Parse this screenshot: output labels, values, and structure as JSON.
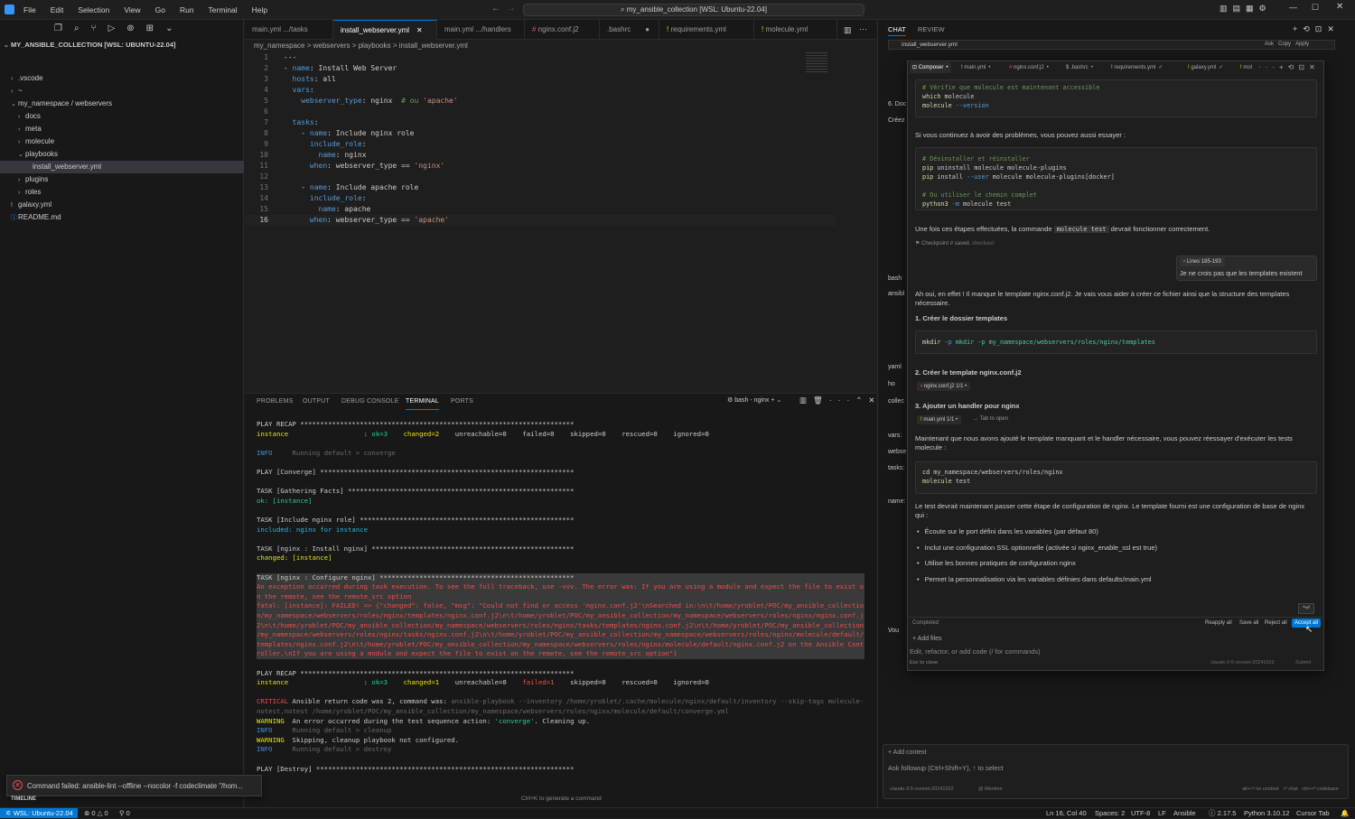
{
  "menu": [
    "File",
    "Edit",
    "Selection",
    "View",
    "Go",
    "Run",
    "Terminal",
    "Help"
  ],
  "command_center": "my_ansible_collection [WSL: Ubuntu-22.04]",
  "explorer": {
    "root": "MY_ANSIBLE_COLLECTION [WSL: UBUNTU-22.04]",
    "items": [
      {
        "label": ".vscode",
        "type": "folder"
      },
      {
        "label": "~",
        "type": "folder"
      },
      {
        "label": "my_namespace / webservers",
        "type": "folder-open"
      },
      {
        "label": "docs",
        "type": "folder"
      },
      {
        "label": "meta",
        "type": "folder"
      },
      {
        "label": "molecule",
        "type": "folder"
      },
      {
        "label": "playbooks",
        "type": "folder-open"
      },
      {
        "label": "install_webserver.yml",
        "type": "file"
      },
      {
        "label": "plugins",
        "type": "folder"
      },
      {
        "label": "roles",
        "type": "folder"
      },
      {
        "label": "galaxy.yml",
        "type": "file"
      },
      {
        "label": "README.md",
        "type": "file"
      }
    ]
  },
  "tabs": [
    {
      "label": "main.yml .../tasks"
    },
    {
      "label": "install_webserver.yml"
    },
    {
      "label": "main.yml .../handlers"
    },
    {
      "label": "nginx.conf.j2"
    },
    {
      "label": ".bashrc"
    },
    {
      "label": "requirements.yml"
    },
    {
      "label": "molecule.yml"
    }
  ],
  "breadcrumb": "my_namespace  >  webservers  >  playbooks  >  install_webserver.yml",
  "code": [
    {
      "n": "1",
      "t": "---"
    },
    {
      "n": "2",
      "t": "- name: Install Web Server"
    },
    {
      "n": "3",
      "t": "  hosts: all"
    },
    {
      "n": "4",
      "t": "  vars:"
    },
    {
      "n": "5",
      "t": "    webserver_type: nginx  # ou 'apache'"
    },
    {
      "n": "6",
      "t": ""
    },
    {
      "n": "7",
      "t": "  tasks:"
    },
    {
      "n": "8",
      "t": "    - name: Include nginx role"
    },
    {
      "n": "9",
      "t": "      include_role:"
    },
    {
      "n": "10",
      "t": "        name: nginx"
    },
    {
      "n": "11",
      "t": "      when: webserver_type == 'nginx'"
    },
    {
      "n": "12",
      "t": ""
    },
    {
      "n": "13",
      "t": "    - name: Include apache role"
    },
    {
      "n": "14",
      "t": "      include_role:"
    },
    {
      "n": "15",
      "t": "        name: apache"
    },
    {
      "n": "16",
      "t": "      when: webserver_type == 'apache'"
    }
  ],
  "panel_tabs": [
    "PROBLEMS",
    "OUTPUT",
    "DEBUG CONSOLE",
    "TERMINAL",
    "PORTS"
  ],
  "terminal_name": "bash - nginx",
  "terminal": [
    {
      "t": "PLAY RECAP *********************************************************************",
      "c": ""
    },
    {
      "t": "instance                   : ok=3    changed=2    unreachable=0    failed=0    skipped=0    rescued=0    ignored=0",
      "c": "recap"
    },
    {
      "t": "",
      "c": ""
    },
    {
      "t": "INFO     Running default > converge",
      "c": "info"
    },
    {
      "t": "",
      "c": ""
    },
    {
      "t": "PLAY [Converge] ****************************************************************",
      "c": ""
    },
    {
      "t": "",
      "c": ""
    },
    {
      "t": "TASK [Gathering Facts] *********************************************************",
      "c": ""
    },
    {
      "t": "ok: [instance]",
      "c": "green"
    },
    {
      "t": "",
      "c": ""
    },
    {
      "t": "TASK [Include nginx role] ******************************************************",
      "c": ""
    },
    {
      "t": "included: nginx for instance",
      "c": "cyan"
    },
    {
      "t": "",
      "c": ""
    },
    {
      "t": "TASK [nginx : Install nginx] ***************************************************",
      "c": ""
    },
    {
      "t": "changed: [instance]",
      "c": "yel"
    },
    {
      "t": "",
      "c": ""
    },
    {
      "t": "TASK [nginx : Configure nginx] *************************************************",
      "c": "hl"
    },
    {
      "t": "An exception occurred during task execution. To see the full traceback, use -vvv. The error was: If you are using a module and expect the file to exist o",
      "c": "red"
    },
    {
      "t": "n the remote, see the remote_src option",
      "c": "red"
    },
    {
      "t": "fatal: [instance]: FAILED! => {\"changed\": false, \"msg\": \"Could not find or access 'nginx.conf.j2'\\nSearched in:\\n\\t/home/yroblet/POC/my_ansible_collectio",
      "c": "red"
    },
    {
      "t": "n/my_namespace/webservers/roles/nginx/templates/nginx.conf.j2\\n\\t/home/yroblet/POC/my_ansible_collection/my_namespace/webservers/roles/nginx/nginx.conf.j",
      "c": "red"
    },
    {
      "t": "2\\n\\t/home/yroblet/POC/my_ansible_collection/my_namespace/webservers/roles/nginx/tasks/templates/nginx.conf.j2\\n\\t/home/yroblet/POC/my_ansible_collection",
      "c": "red"
    },
    {
      "t": "/my_namespace/webservers/roles/nginx/tasks/nginx.conf.j2\\n\\t/home/yroblet/POC/my_ansible_collection/my_namespace/webservers/roles/nginx/molecule/default/",
      "c": "red"
    },
    {
      "t": "templates/nginx.conf.j2\\n\\t/home/yroblet/POC/my_ansible_collection/my_namespace/webservers/roles/nginx/molecule/default/nginx.conf.j2 on the Ansible Cont",
      "c": "red"
    },
    {
      "t": "roller.\\nIf you are using a module and expect the file to exist on the remote, see the remote_src option\"}",
      "c": "red"
    },
    {
      "t": "",
      "c": ""
    },
    {
      "t": "PLAY RECAP *********************************************************************",
      "c": ""
    },
    {
      "t": "instance                   : ok=3    changed=1    unreachable=0    failed=1    skipped=0    rescued=0    ignored=0",
      "c": "recap2"
    },
    {
      "t": "",
      "c": ""
    },
    {
      "t": "CRITICAL Ansible return code was 2, command was: ansible-playbook --inventory /home/yroblet/.cache/molecule/nginx/default/inventory --skip-tags molecule-",
      "c": "crit"
    },
    {
      "t": "notest,notest /home/yroblet/POC/my_ansible_collection/my_namespace/webservers/roles/nginx/molecule/default/converge.yml",
      "c": "gray2"
    },
    {
      "t": "WARNING  An error occurred during the test sequence action: 'converge'. Cleaning up.",
      "c": "warn"
    },
    {
      "t": "INFO     Running default > cleanup",
      "c": "info"
    },
    {
      "t": "WARNING  Skipping, cleanup playbook not configured.",
      "c": "warn"
    },
    {
      "t": "INFO     Running default > destroy",
      "c": "info"
    },
    {
      "t": "",
      "c": ""
    },
    {
      "t": "PLAY [Destroy] *****************************************************************",
      "c": ""
    }
  ],
  "toast": "Command failed: ansible-lint --offline --nocolor -f codeclimate \"/hom...",
  "terminal_hint": "Ctrl+K to generate a command",
  "timeline": "TIMELINE",
  "chat": {
    "tabs": [
      "CHAT",
      "REVIEW"
    ],
    "file_chip": "install_webserver.yml",
    "header_actions": [
      "Ask",
      "Copy",
      "Apply"
    ],
    "composer_tabs": [
      "Composer",
      "main.yml",
      "nginx.conf.j2",
      ".bashrc",
      "requirements.yml",
      "galaxy.yml",
      "mol"
    ],
    "code1": [
      "# Vérifie que molecule est maintenant accessible",
      "which molecule",
      "molecule --version"
    ],
    "p1": "Si vous continuez à avoir des problèmes, vous pouvez aussi essayer :",
    "code2": [
      "# Désinstaller et réinstaller",
      "pip uninstall molecule molecule-plugins",
      "pip install --user molecule molecule-plugins[docker]",
      "",
      "# Ou utiliser le chemin complet",
      "python3 -m molecule test"
    ],
    "p2a": "Une fois ces étapes effectuées, la commande",
    "p2code": "molecule test",
    "p2b": "devrait fonctionner correctement.",
    "checkpoint": "Checkpoint # saved.",
    "checkout": "checkout",
    "user_ref": "Lines 185-193",
    "user_msg": "Je ne crois pas que les templates existent",
    "p3": "Ah oui, en effet ! Il manque le template nginx.conf.j2. Je vais vous aider à créer ce fichier ainsi que la structure des templates nécessaire.",
    "h1": "1. Créer le dossier templates",
    "code3": "mkdir -p my_namespace/webservers/roles/nginx/templates",
    "h2": "2. Créer le template nginx.conf.j2",
    "chip1": "nginx.conf.j2  1/1",
    "h3": "3. Ajouter un handler pour nginx",
    "chip2": "main.yml  1/1",
    "chip2b": "Tab to open",
    "p4": "Maintenant que nous avons ajouté le template manquant et le handler nécessaire, vous pouvez réessayer d'exécuter les tests molecule :",
    "code4": [
      "cd my_namespace/webservers/roles/nginx",
      "molecule test"
    ],
    "p5": "Le test devrait maintenant passer cette étape de configuration de nginx. Le template fourni est une configuration de base de nginx qui :",
    "bullets": [
      "Écoute sur le port défini dans les variables (par défaut 80)",
      "Inclut une configuration SSL optionnelle (activée si nginx_enable_ssl est true)",
      "Utilise les bonnes pratiques de configuration nginx",
      "Permet la personnalisation via les variables définies dans defaults/main.yml"
    ],
    "status": "Completed",
    "actions": [
      "Reapply all",
      "Save all",
      "Reject all",
      "Accept all"
    ],
    "add_files": "Add files",
    "input_placeholder": "Edit, refactor, or add code (/ for commands)",
    "esc": "Esc to close",
    "model": "claude-3-5-sonnet-20241022",
    "submit": "Submit",
    "add_context": "Add context",
    "followup_placeholder": "Ask followup (Ctrl+Shift+Y), ↑ to select",
    "model2": "claude-3-5-sonnet-20241022",
    "mention": "@ Mention",
    "footer": [
      "alt+⏎ no context",
      "⏎ chat",
      "ctrl+⏎ codebase"
    ],
    "side_peek": [
      "6. Doc",
      "Créez",
      "bash",
      "ansibl",
      "yaml",
      "ho",
      "collec",
      "vars:",
      "webse",
      "tasks:",
      "name:",
      "Vou"
    ]
  },
  "statusbar": {
    "remote": "WSL: Ubuntu-22.04",
    "problems": "0 △ 0",
    "ports": "0",
    "position": "Ln 16, Col 40",
    "spaces": "Spaces: 2",
    "encoding": "UTF-8",
    "eol": "LF",
    "lang": "Ansible",
    "ansible_ver": "2.17.5",
    "python": "Python 3.10.12",
    "cursor_tab": "Cursor Tab"
  },
  "colors": {
    "accent": "#0078d4",
    "remote_bg": "#16825d"
  }
}
